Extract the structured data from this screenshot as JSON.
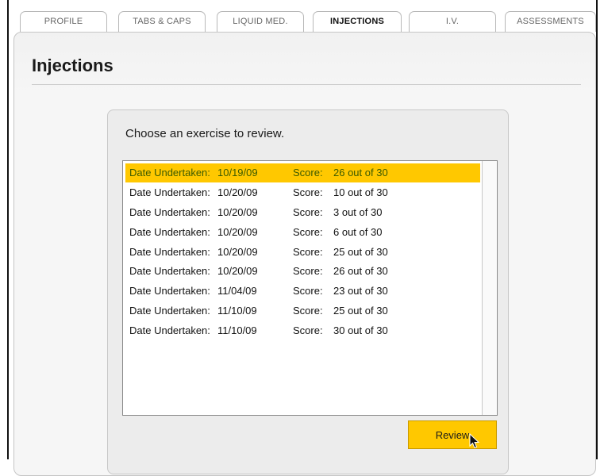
{
  "tabs": [
    {
      "label": "PROFILE",
      "active": false
    },
    {
      "label": "TABS & CAPS",
      "active": false
    },
    {
      "label": "LIQUID MED.",
      "active": false
    },
    {
      "label": "INJECTIONS",
      "active": true
    },
    {
      "label": "I.V.",
      "active": false
    },
    {
      "label": "ASSESSMENTS",
      "active": false
    }
  ],
  "page": {
    "title": "Injections"
  },
  "card": {
    "prompt": "Choose an exercise to review."
  },
  "list": {
    "date_label": "Date Undertaken:",
    "score_label": "Score:",
    "selected_index": 0,
    "items": [
      {
        "date": "10/19/09",
        "score": "26 out of 30"
      },
      {
        "date": "10/20/09",
        "score": "10 out of 30"
      },
      {
        "date": "10/20/09",
        "score": "3 out of 30"
      },
      {
        "date": "10/20/09",
        "score": "6 out of 30"
      },
      {
        "date": "10/20/09",
        "score": "25 out of 30"
      },
      {
        "date": "10/20/09",
        "score": "26 out of 30"
      },
      {
        "date": "11/04/09",
        "score": "23 out of 30"
      },
      {
        "date": "11/10/09",
        "score": "25 out of 30"
      },
      {
        "date": "11/10/09",
        "score": "30 out of 30"
      }
    ]
  },
  "actions": {
    "review_label": "Review"
  },
  "colors": {
    "accent": "#ffc800",
    "selected_text": "#3a5a00"
  },
  "icons": {
    "cursor": "mouse-pointer-icon"
  }
}
